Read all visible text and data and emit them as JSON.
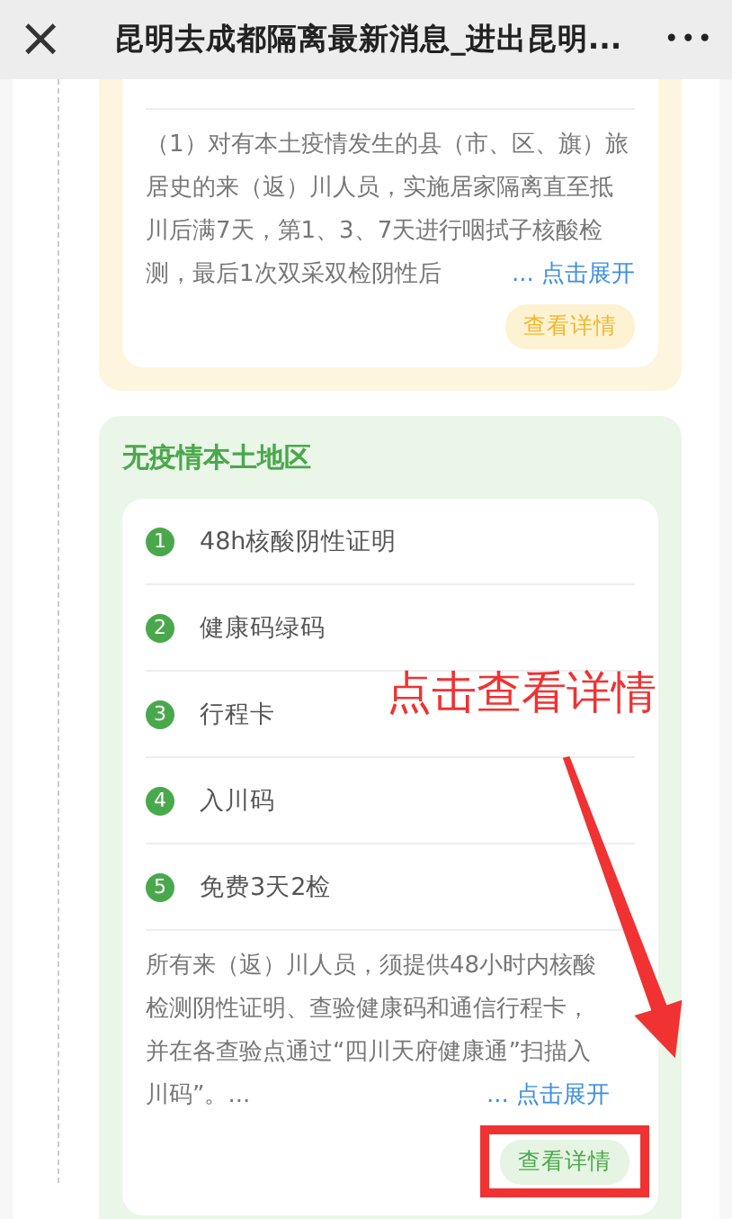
{
  "header": {
    "close_icon": "×",
    "title": "昆明去成都隔离最新消息_进出昆明...",
    "more": "•••"
  },
  "sections": [
    {
      "kind": "risk",
      "description": "（1）对有本土疫情发生的县（市、区、旗）旅居史的来（返）川人员，实施居家隔离直至抵川后满7天，第1、3、7天进行咽拭子核酸检测，最后1次双采双检阴性后",
      "expand": "... 点击展开",
      "details_button": "查看详情"
    },
    {
      "kind": "safe",
      "title": "无疫情本土地区",
      "items": [
        {
          "number": "1",
          "text": "48h核酸阴性证明"
        },
        {
          "number": "2",
          "text": "健康码绿码"
        },
        {
          "number": "3",
          "text": "行程卡"
        },
        {
          "number": "4",
          "text": "入川码"
        },
        {
          "number": "5",
          "text": "免费3天2检"
        }
      ],
      "description": "所有来（返）川人员，须提供48小时内核酸检测阴性证明、查验健康码和通信行程卡，并在各查验点通过“四川天府健康通”扫描入川码”。...",
      "expand": "... 点击展开",
      "details_button": "查看详情"
    }
  ],
  "annotation": {
    "text": "点击查看详情"
  }
}
